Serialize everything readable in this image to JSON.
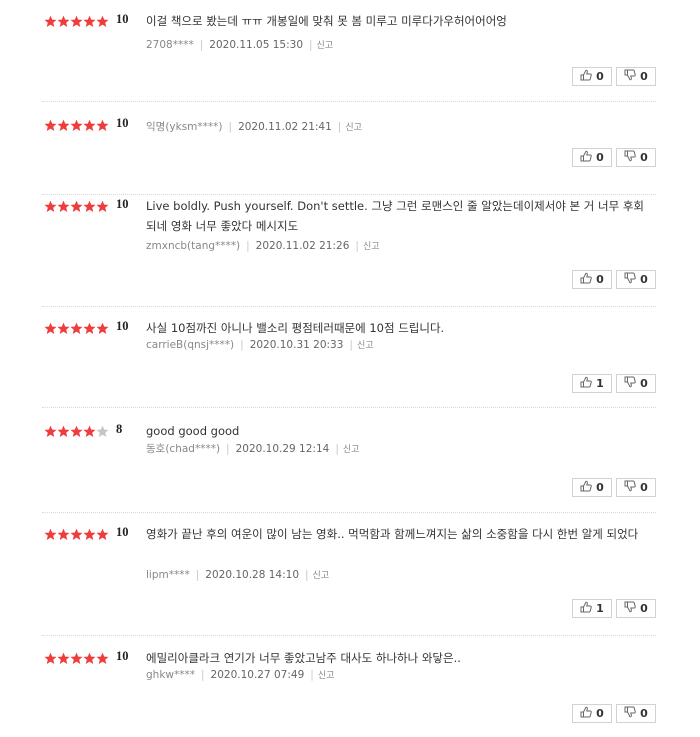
{
  "labels": {
    "report": "신고"
  },
  "colors": {
    "star_on": "#ee3d3d",
    "star_off": "#c5c5c5"
  },
  "icons": {
    "like": "thumbs-up-icon",
    "dislike": "thumbs-down-icon"
  },
  "reviews": [
    {
      "stars": 5,
      "score": "10",
      "text": "이걸 책으로 봤는데 ㅠㅠ 개봉일에 맞춰 못 봄 미루고 미루다가우허어어어엉",
      "user": "2708****",
      "date": "2020.11.05 15:30",
      "likes": "0",
      "dislikes": "0"
    },
    {
      "stars": 5,
      "score": "10",
      "text": "",
      "user": "익명(yksm****)",
      "date": "2020.11.02 21:41",
      "likes": "0",
      "dislikes": "0"
    },
    {
      "stars": 5,
      "score": "10",
      "text": "Live boldly. Push yourself. Don't settle. 그냥 그런 로맨스인 줄 알았는데이제서야 본 거 너무 후회되네 영화 너무 좋았다 메시지도",
      "user": "zmxncb(tang****)",
      "date": "2020.11.02 21:26",
      "likes": "0",
      "dislikes": "0"
    },
    {
      "stars": 5,
      "score": "10",
      "text": "사실 10점까진 아니나 밸소리 평점테러때문에 10점 드립니다.",
      "user": "carrieB(qnsj****)",
      "date": "2020.10.31 20:33",
      "likes": "1",
      "dislikes": "0"
    },
    {
      "stars": 4,
      "score": "8",
      "text": "good good good",
      "user": "동호(chad****)",
      "date": "2020.10.29 12:14",
      "likes": "0",
      "dislikes": "0"
    },
    {
      "stars": 5,
      "score": "10",
      "text": "영화가 끝난 후의 여운이 많이 남는 영화.. 먹먹함과 함께느껴지는 삶의 소중함을 다시 한번 알게 되었다",
      "user": "lipm****",
      "date": "2020.10.28 14:10",
      "likes": "1",
      "dislikes": "0"
    },
    {
      "stars": 5,
      "score": "10",
      "text": "에밀리아클라크 연기가 너무 좋았고남주 대사도 하나하나 와닿은..",
      "user": "ghkw****",
      "date": "2020.10.27 07:49",
      "likes": "0",
      "dislikes": "0"
    }
  ]
}
